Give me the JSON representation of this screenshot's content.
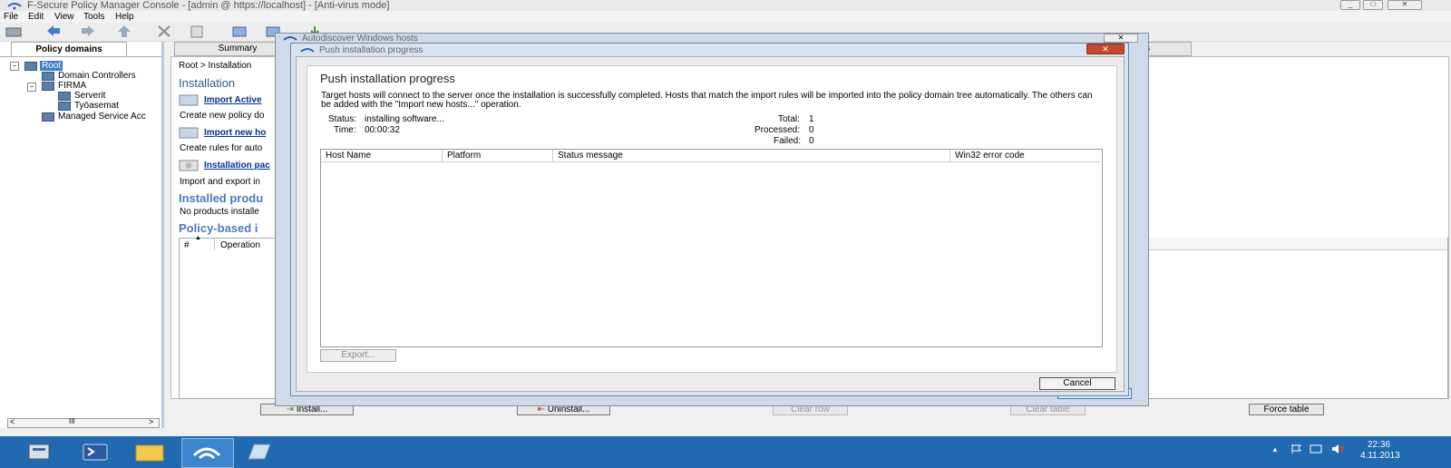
{
  "window": {
    "title": "F-Secure Policy Manager Console - [admin @ https://localhost] - [Anti-virus mode]",
    "menu": [
      "File",
      "Edit",
      "View",
      "Tools",
      "Help"
    ]
  },
  "left_panel": {
    "tab": "Policy domains",
    "tree": {
      "root": "Root",
      "domain_controllers": "Domain Controllers",
      "firma": "FIRMA",
      "serverit": "Serverit",
      "tyoasemat": "Työasemat",
      "managed": "Managed Service Acc"
    },
    "scroll_thumb": "III"
  },
  "main": {
    "tab_summary": "Summary",
    "tab_partial": "s",
    "breadcrumb": "Root > Installation",
    "heading": "Installation",
    "link1": "Import Active",
    "desc1": "Create new policy do",
    "link2": "Import new ho",
    "desc2": "Create rules for auto",
    "link3": "Installation pac",
    "desc3": "Import and export in",
    "installed_heading": "Installed produ",
    "installed_text": "No products installe",
    "policy_heading": "Policy-based i",
    "table_col_hash": "#",
    "table_col_operation": "Operation",
    "buttons": {
      "install": "Install...",
      "uninstall": "Uninstall...",
      "clear_row": "Clear row",
      "clear_table": "Clear table",
      "force_table": "Force table"
    }
  },
  "back_dialog": {
    "title": "Autodiscover Windows hosts",
    "close_label": "Close"
  },
  "dialog": {
    "title": "Push installation progress",
    "heading": "Push installation progress",
    "description": "Target hosts will connect to the server once the installation is successfully completed. Hosts that match the import rules will be imported into the policy domain tree automatically. The others can be added with the \"Import new hosts...\" operation.",
    "status_label": "Status:",
    "status_value": "installing software...",
    "time_label": "Time:",
    "time_value": "00:00:32",
    "total_label": "Total:",
    "total_value": "1",
    "processed_label": "Processed:",
    "processed_value": "0",
    "failed_label": "Failed:",
    "failed_value": "0",
    "columns": [
      "Host Name",
      "Platform",
      "Status message",
      "Win32 error code"
    ],
    "export_button": "Export...",
    "cancel_button": "Cancel"
  },
  "taskbar": {
    "time": "22:36",
    "date": "4.11.2013"
  }
}
